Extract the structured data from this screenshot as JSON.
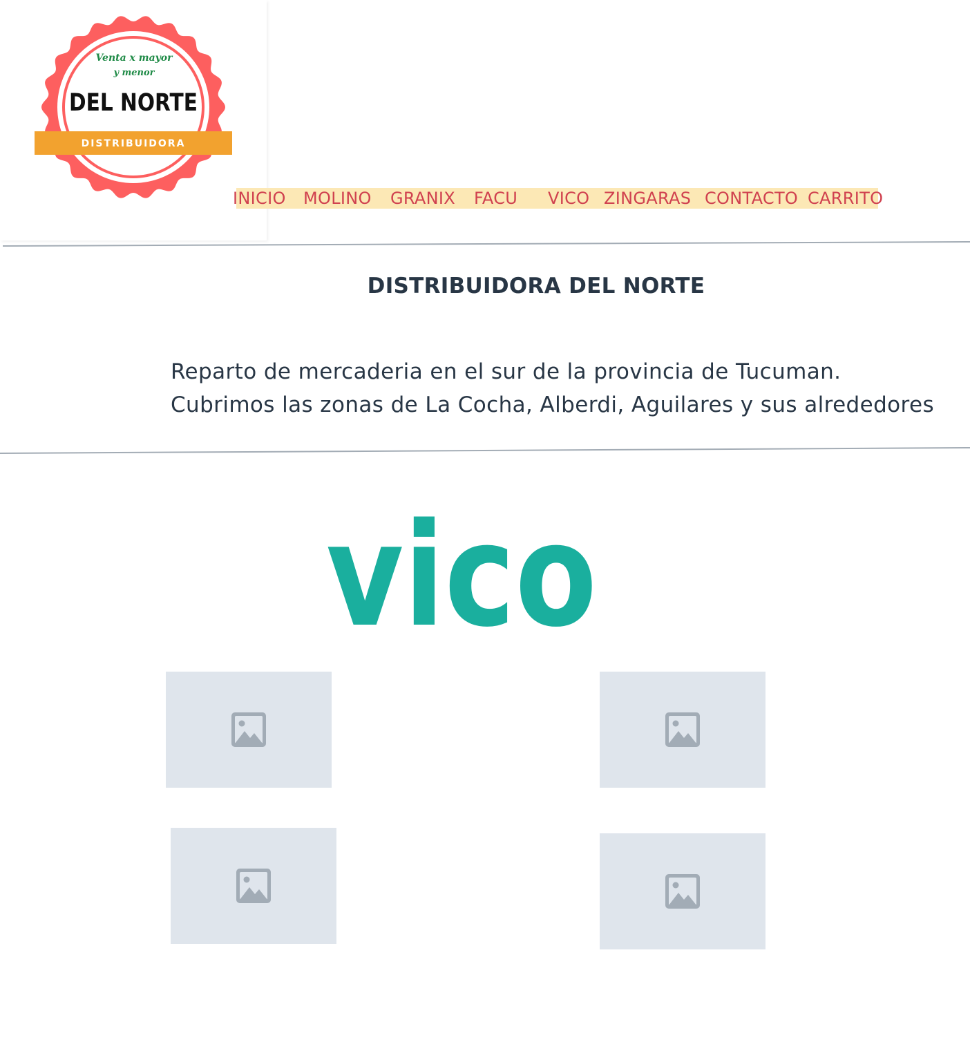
{
  "logo": {
    "tagline_line1": "Venta x mayor",
    "tagline_line2": "y menor",
    "name": "DEL NORTE",
    "ribbon": "DISTRIBUIDORA",
    "colors": {
      "badge": "#fd5f5f",
      "ribbon": "#f2a22f",
      "tagline": "#1e8a46",
      "name": "#111111"
    }
  },
  "nav": {
    "items": [
      {
        "label": "INICIO"
      },
      {
        "label": "MOLINO"
      },
      {
        "label": "GRANIX"
      },
      {
        "label": "FACU"
      },
      {
        "label": "VICO"
      },
      {
        "label": "ZINGARAS"
      },
      {
        "label": "CONTACTO"
      },
      {
        "label": "CARRITO"
      }
    ],
    "colors": {
      "text": "#d0414f",
      "background": "#fce8b5"
    }
  },
  "header": {
    "title": "DISTRIBUIDORA DEL NORTE",
    "description_line1": "Reparto de mercaderia en el sur de la provincia de Tucuman.",
    "description_line2": "Cubrimos las zonas de La Cocha, Alberdi, Aguilares y sus alrededores"
  },
  "brand": {
    "title": "vico",
    "color": "#1aaf9e"
  },
  "gallery": {
    "images": [
      {
        "icon": "image-placeholder-icon"
      },
      {
        "icon": "image-placeholder-icon"
      },
      {
        "icon": "image-placeholder-icon"
      },
      {
        "icon": "image-placeholder-icon"
      }
    ]
  }
}
